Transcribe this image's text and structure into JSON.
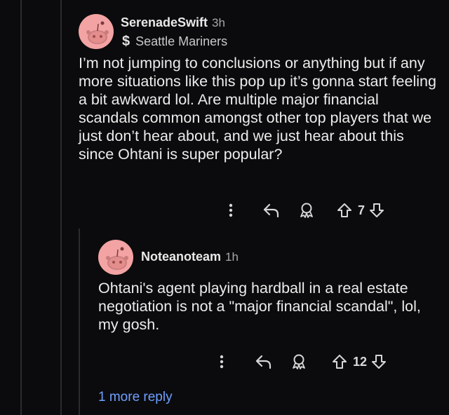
{
  "comments": [
    {
      "username": "SerenadeSwift",
      "time": "3h",
      "flair": "Seattle Mariners",
      "body": "I’m not jumping to conclusions or anything but if any more situations like this pop up it’s gonna start feeling a bit awkward lol. Are multiple major financial scandals common amongst other top players that we just don’t hear about, and we just hear about this since Ohtani is super popular?",
      "score": "7"
    },
    {
      "username": "Noteanoteam",
      "time": "1h",
      "body": "Ohtani's agent playing hardball in a real estate negotiation is not a \"major financial scandal\", lol, my gosh.",
      "score": "12"
    }
  ],
  "more_replies_label": "1 more reply",
  "icons": [
    "more-vertical-icon",
    "reply-icon",
    "award-icon",
    "upvote-icon",
    "downvote-icon",
    "snoo-avatar-icon",
    "flair-s-icon"
  ],
  "colors": {
    "background": "#0b0b0d",
    "avatar": "#f3a3a3",
    "link": "#6ea0ff",
    "text": "#ececec"
  }
}
